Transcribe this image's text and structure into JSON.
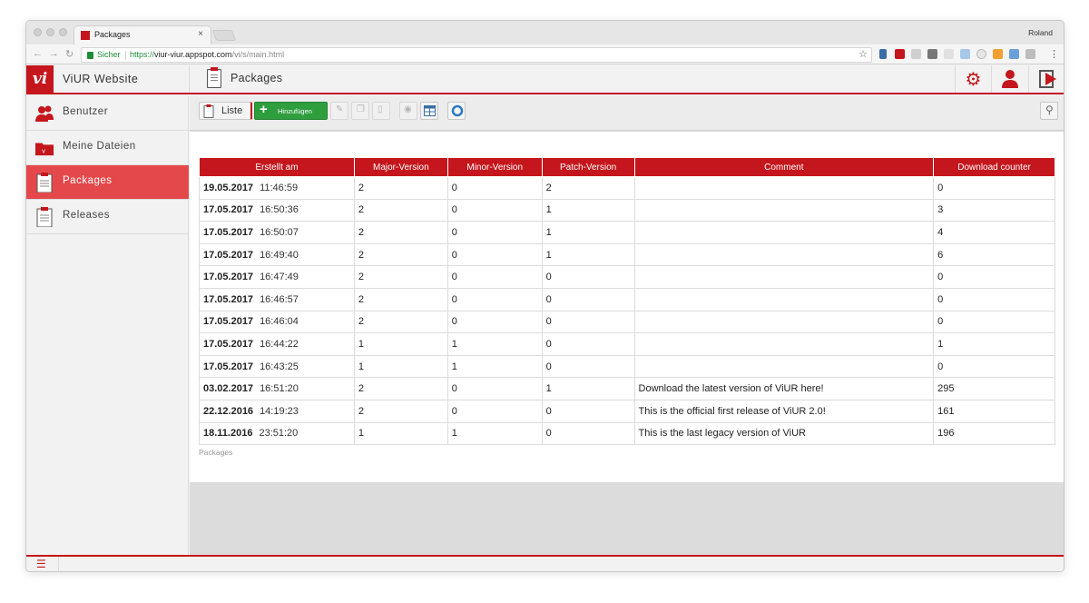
{
  "browser": {
    "tab_title": "Packages",
    "tab_close": "×",
    "profile_name": "Roland",
    "secure_label": "Sicher",
    "url_scheme": "https://",
    "url_domain": "viur-viur.appspot.com",
    "url_path": "/vi/s/main.html"
  },
  "app": {
    "logo_text": "vi",
    "site_title": "ViUR Website",
    "page_title": "Packages",
    "accent_color": "#c4161c"
  },
  "sidebar": {
    "items": [
      {
        "label": "Benutzer",
        "icon": "users-icon"
      },
      {
        "label": "Meine Dateien",
        "icon": "folder-icon"
      },
      {
        "label": "Packages",
        "icon": "clipboard-icon",
        "active": true
      },
      {
        "label": "Releases",
        "icon": "clipboard-icon"
      }
    ]
  },
  "toolbar": {
    "list_label": "Liste",
    "add_label": "Hinzufügen"
  },
  "table": {
    "columns": [
      "Erstellt am",
      "Major-Version",
      "Minor-Version",
      "Patch-Version",
      "Comment",
      "Download counter"
    ],
    "rows": [
      {
        "date": "19.05.2017",
        "time": "11:46:59",
        "major": "2",
        "minor": "0",
        "patch": "2",
        "comment": "",
        "downloads": "0"
      },
      {
        "date": "17.05.2017",
        "time": "16:50:36",
        "major": "2",
        "minor": "0",
        "patch": "1",
        "comment": "",
        "downloads": "3"
      },
      {
        "date": "17.05.2017",
        "time": "16:50:07",
        "major": "2",
        "minor": "0",
        "patch": "1",
        "comment": "",
        "downloads": "4"
      },
      {
        "date": "17.05.2017",
        "time": "16:49:40",
        "major": "2",
        "minor": "0",
        "patch": "1",
        "comment": "",
        "downloads": "6"
      },
      {
        "date": "17.05.2017",
        "time": "16:47:49",
        "major": "2",
        "minor": "0",
        "patch": "0",
        "comment": "",
        "downloads": "0"
      },
      {
        "date": "17.05.2017",
        "time": "16:46:57",
        "major": "2",
        "minor": "0",
        "patch": "0",
        "comment": "",
        "downloads": "0"
      },
      {
        "date": "17.05.2017",
        "time": "16:46:04",
        "major": "2",
        "minor": "0",
        "patch": "0",
        "comment": "",
        "downloads": "0"
      },
      {
        "date": "17.05.2017",
        "time": "16:44:22",
        "major": "1",
        "minor": "1",
        "patch": "0",
        "comment": "",
        "downloads": "1"
      },
      {
        "date": "17.05.2017",
        "time": "16:43:25",
        "major": "1",
        "minor": "1",
        "patch": "0",
        "comment": "",
        "downloads": "0"
      },
      {
        "date": "03.02.2017",
        "time": "16:51:20",
        "major": "2",
        "minor": "0",
        "patch": "1",
        "comment": "Download the latest version of ViUR here!",
        "downloads": "295"
      },
      {
        "date": "22.12.2016",
        "time": "14:19:23",
        "major": "2",
        "minor": "0",
        "patch": "0",
        "comment": "This is the official first release of ViUR 2.0!",
        "downloads": "161"
      },
      {
        "date": "18.11.2016",
        "time": "23:51:20",
        "major": "1",
        "minor": "1",
        "patch": "0",
        "comment": "This is the last legacy version of ViUR",
        "downloads": "196"
      }
    ],
    "caption": "Packages"
  }
}
